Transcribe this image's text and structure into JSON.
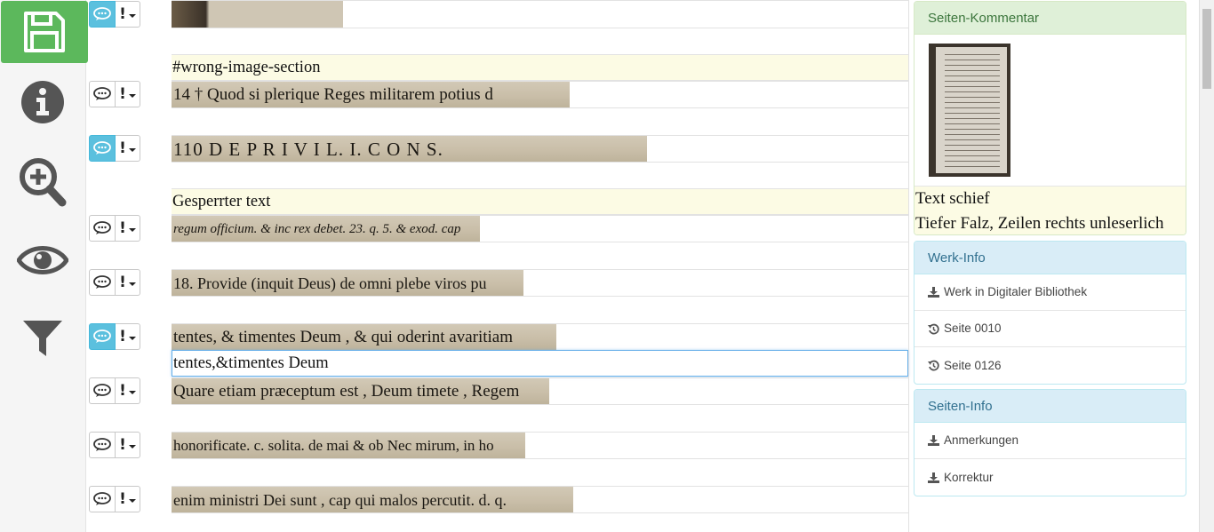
{
  "sidebar": {
    "buttons": [
      {
        "icon": "save-icon"
      },
      {
        "icon": "info-icon"
      },
      {
        "icon": "zoom-in-icon"
      },
      {
        "icon": "eye-icon"
      },
      {
        "icon": "filter-icon"
      }
    ],
    "accent": "#5cb85c"
  },
  "lines": [
    {
      "scan_text": "",
      "comment_active": true
    },
    {
      "scan_text": "14   † Quod si plerique Reges militarem potius d",
      "comment_active": false,
      "marker": "#wrong-image-section"
    },
    {
      "scan_text": "110      D E  P R I V I L.  I.  C O N S.",
      "comment_active": true
    },
    {
      "scan_text": "regum officium. & inc rex debet. 23. q. 5. & exod. cap",
      "comment_active": false,
      "marker": "Gesperrter text"
    },
    {
      "scan_text": "18. Provide (inquit Deus) de omni plebe viros pu",
      "comment_active": false
    },
    {
      "scan_text": "tentes, & timentes Deum , & qui oderint avaritiam",
      "comment_active": true,
      "transcription": "tentes,&timentes Deum"
    },
    {
      "scan_text": "Quare etiam præceptum est , Deum timete , Regem",
      "comment_active": false
    },
    {
      "scan_text": "honorificate. c. solita. de mai & ob Nec mirum, in ho",
      "comment_active": false
    },
    {
      "scan_text": "enim ministri Dei sunt , cap qui malos percutit. d. q.",
      "comment_active": false
    }
  ],
  "right": {
    "page_comment": {
      "title": "Seiten-Kommentar",
      "comments": [
        "Text schief",
        "Tiefer Falz, Zeilen rechts unleserlich"
      ]
    },
    "werk_info": {
      "title": "Werk-Info",
      "items": [
        {
          "icon": "download-icon",
          "label": "Werk in Digitaler Bibliothek"
        },
        {
          "icon": "history-icon",
          "label": "Seite 0010"
        },
        {
          "icon": "history-icon",
          "label": "Seite 0126"
        }
      ]
    },
    "seiten_info": {
      "title": "Seiten-Info",
      "items": [
        {
          "icon": "download-icon",
          "label": "Anmerkungen"
        },
        {
          "icon": "download-icon",
          "label": "Korrektur"
        }
      ]
    }
  },
  "colors": {
    "comment_active": "#5bc0de",
    "highlight": "#fcfbe4",
    "panel_green": "#dff0d8",
    "panel_blue": "#d9edf7"
  }
}
